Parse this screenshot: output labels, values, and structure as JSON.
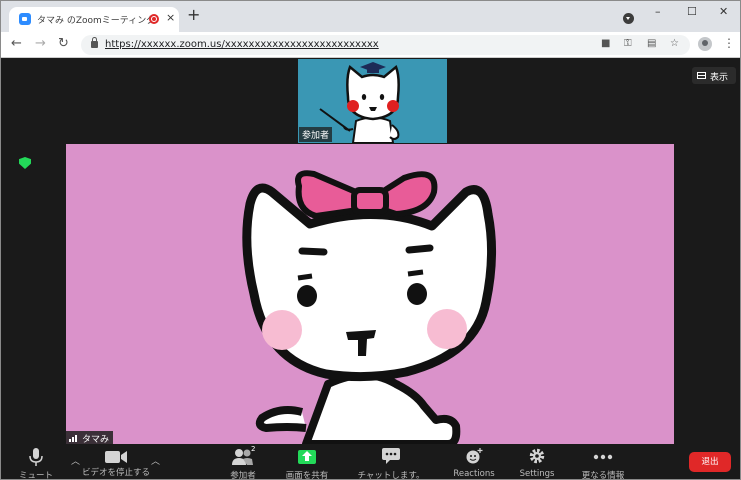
{
  "browser": {
    "tab_title": "タマみ のZoomミーティング",
    "new_tab_label": "+",
    "url": "https://xxxxxx.zoom.us/xxxxxxxxxxxxxxxxxxxxxxxxxx",
    "window_controls": [
      "–",
      "☐",
      "✕"
    ],
    "tab_close": "×",
    "menu": "⋮"
  },
  "meeting": {
    "thumbnail_label": "参加者",
    "view_button_label": "表示",
    "main_name": "タマみ"
  },
  "controls": {
    "mute_label": "ミュート",
    "video_label": "ビデオを停止する",
    "participants_label": "参加者",
    "participants_count": "2",
    "share_label": "画面を共有",
    "chat_label": "チャットします。",
    "reactions_label": "Reactions",
    "settings_label": "Settings",
    "more_label": "更なる情報",
    "leave_label": "退出"
  },
  "colors": {
    "thumb_bg": "#3a97b4",
    "main_bg": "#da92ca",
    "share_green": "#23d959",
    "leave_red": "#e02828"
  }
}
